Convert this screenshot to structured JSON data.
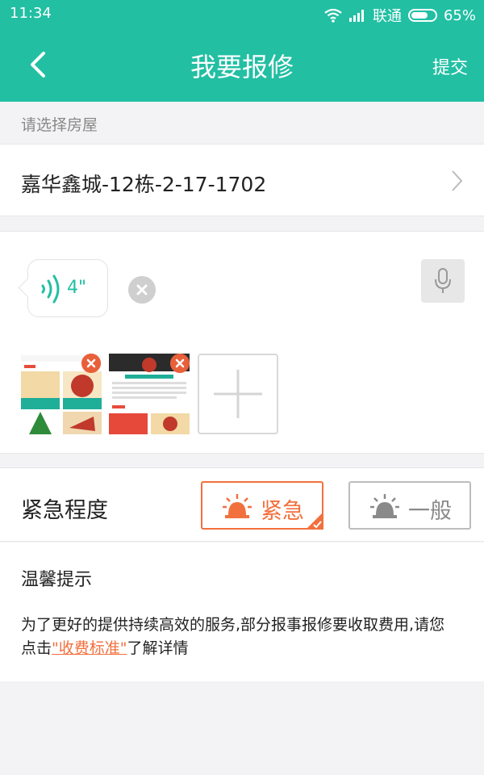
{
  "status_bar": {
    "time": "11:34",
    "carrier": "联通",
    "battery": "65%"
  },
  "header": {
    "title": "我要报修",
    "submit_label": "提交"
  },
  "house": {
    "section_label": "请选择房屋",
    "address": "嘉华鑫城-12栋-2-17-1702"
  },
  "voice": {
    "duration": "4\""
  },
  "urgency": {
    "label": "紧急程度",
    "options": [
      {
        "label": "紧急",
        "selected": true
      },
      {
        "label": "一般",
        "selected": false
      }
    ]
  },
  "tips": {
    "title": "温馨提示",
    "body_line1": "为了更好的提供持续高效的服务,部分报事报修要收取费用,请您",
    "body_prefix": "点击",
    "link_text": "\"收费标准\"",
    "body_suffix": "了解详情"
  },
  "colors": {
    "primary": "#22bfa3",
    "accent": "#f2703d",
    "background": "#f3f3f5"
  }
}
